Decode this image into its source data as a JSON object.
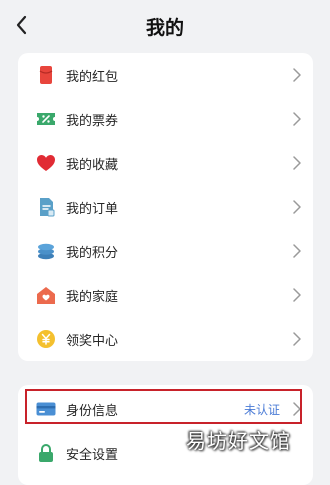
{
  "header": {
    "title": "我的"
  },
  "menu": {
    "items": [
      {
        "label": "我的红包",
        "icon": "red-packet-icon"
      },
      {
        "label": "我的票券",
        "icon": "coupon-ticket-icon"
      },
      {
        "label": "我的收藏",
        "icon": "heart-icon"
      },
      {
        "label": "我的订单",
        "icon": "order-document-icon"
      },
      {
        "label": "我的积分",
        "icon": "points-coins-icon"
      },
      {
        "label": "我的家庭",
        "icon": "home-icon"
      },
      {
        "label": "领奖中心",
        "icon": "yuan-coin-icon"
      }
    ]
  },
  "account": {
    "items": [
      {
        "label": "身份信息",
        "status": "未认证",
        "icon": "id-card-icon"
      },
      {
        "label": "安全设置",
        "icon": "lock-icon"
      }
    ]
  },
  "watermark": "易坊好文馆",
  "colors": {
    "background": "#f1f2f4",
    "card": "#ffffff",
    "status_blue": "#4a7bd6",
    "highlight_red": "#c8222a"
  }
}
